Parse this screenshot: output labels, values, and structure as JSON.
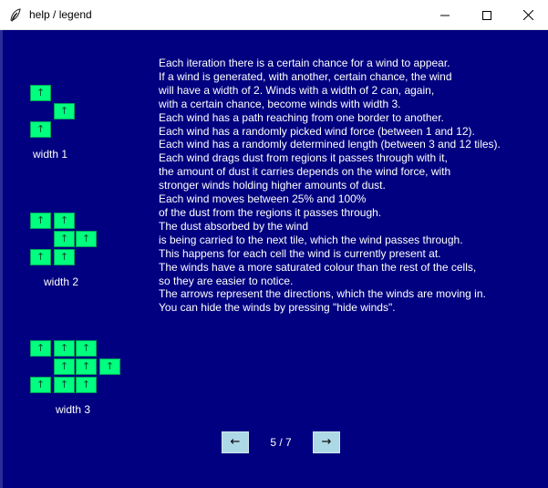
{
  "window": {
    "title": "help / legend"
  },
  "legend": {
    "arrow_glyph": "↑",
    "cell_color": "#00ff7f",
    "background_color": "#000080",
    "groups": [
      {
        "label": "width 1"
      },
      {
        "label": "width 2"
      },
      {
        "label": "width 3"
      }
    ]
  },
  "help_text": [
    "Each iteration there is a certain chance for a wind to appear.",
    "If a wind is generated, with another, certain chance, the wind",
    "will have a width of 2. Winds with a width of 2 can, again,",
    "with a certain chance, become winds with width 3.",
    "Each wind has a path reaching from one border to another.",
    "Each wind has a randomly picked wind force (between 1 and 12).",
    "Each wind has a randomly determined length (between 3 and 12 tiles).",
    "Each wind drags dust from regions it passes through with it,",
    "the amount of dust it carries depends on the wind force, with",
    "stronger winds holding higher amounts of dust.",
    "Each wind moves between 25% and 100%",
    "of the dust from the regions it passes through.",
    "The dust absorbed by the wind",
    "is being carried to the next tile, which the wind passes through.",
    "This happens for each cell the wind is currently present at.",
    "The winds have a more saturated colour than the rest of the cells,",
    "so they are easier to notice.",
    "The arrows represent the directions, which the winds are moving in.",
    "You can hide the winds by pressing \"hide winds\"."
  ],
  "pagination": {
    "prev_label": "←",
    "next_label": "→",
    "indicator": "5 / 7"
  }
}
